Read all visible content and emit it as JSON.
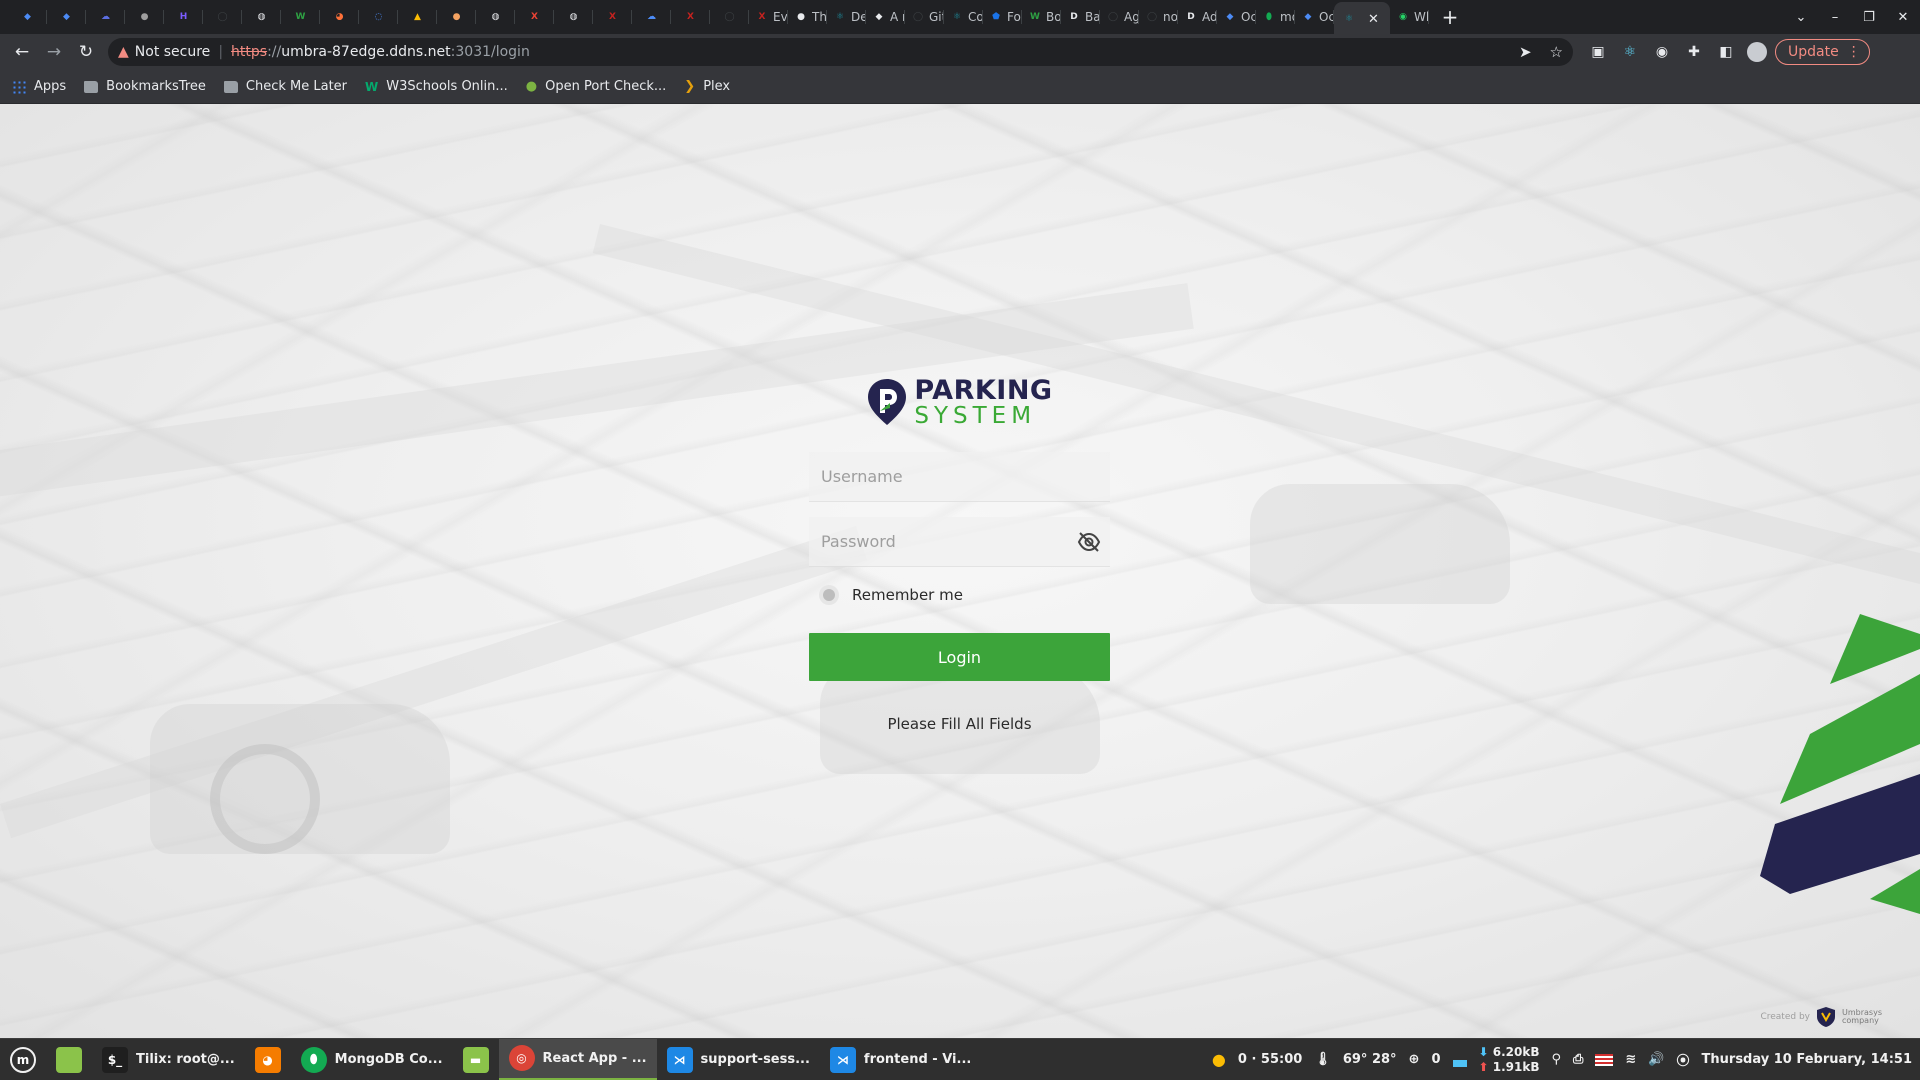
{
  "browser": {
    "tabs": [
      {
        "icon": "diamond-icon",
        "color": "#4c8bf5",
        "label": ""
      },
      {
        "icon": "diamond-icon",
        "color": "#4c8bf5",
        "label": ""
      },
      {
        "icon": "cloud-icon",
        "color": "#5b6ee1",
        "label": ""
      },
      {
        "icon": "apple-icon",
        "color": "#9e9e9e",
        "label": ""
      },
      {
        "icon": "h-icon",
        "color": "#7b5cff",
        "label": ""
      },
      {
        "icon": "github-icon",
        "color": "#3c4043",
        "label": ""
      },
      {
        "icon": "globe-icon",
        "color": "#e8eaed",
        "label": ""
      },
      {
        "icon": "w-icon",
        "color": "#2ea043",
        "label": ""
      },
      {
        "icon": "fox-icon",
        "color": "#ff7139",
        "label": ""
      },
      {
        "icon": "ball-icon",
        "color": "#4c8bf5",
        "label": ""
      },
      {
        "icon": "warning-icon",
        "color": "#fbbc04",
        "label": ""
      },
      {
        "icon": "cookie-icon",
        "color": "#f4a261",
        "label": ""
      },
      {
        "icon": "globe-icon",
        "color": "#e8eaed",
        "label": ""
      },
      {
        "icon": "x-icon",
        "color": "#ea4335",
        "label": ""
      },
      {
        "icon": "globe-icon",
        "color": "#e8eaed",
        "label": ""
      },
      {
        "icon": "x-icon",
        "color": "#c5221f",
        "label": ""
      },
      {
        "icon": "cloud-icon",
        "color": "#4c8bf5",
        "label": ""
      },
      {
        "icon": "x-icon",
        "color": "#c5221f",
        "label": ""
      },
      {
        "icon": "github-icon",
        "color": "#3c4043",
        "label": ""
      },
      {
        "icon": "x-icon",
        "color": "#c5221f",
        "label": "Ev"
      },
      {
        "icon": "user-icon",
        "color": "#e8eaed",
        "label": "Th"
      },
      {
        "icon": "react-icon",
        "color": "#1e8e9e",
        "label": "De"
      },
      {
        "icon": "bird-icon",
        "color": "#e8eaed",
        "label": "A r"
      },
      {
        "icon": "github-icon",
        "color": "#3c4043",
        "label": "Git"
      },
      {
        "icon": "react-icon",
        "color": "#1e8e9e",
        "label": "Co"
      },
      {
        "icon": "shield-icon",
        "color": "#1a73e8",
        "label": "Fo"
      },
      {
        "icon": "w-icon",
        "color": "#2ea043",
        "label": "Bo"
      },
      {
        "icon": "dev-icon",
        "color": "#e8eaed",
        "label": "Ba"
      },
      {
        "icon": "github-icon",
        "color": "#3c4043",
        "label": "Ag"
      },
      {
        "icon": "github-icon",
        "color": "#3c4043",
        "label": "no"
      },
      {
        "icon": "dev-icon",
        "color": "#e8eaed",
        "label": "Ad"
      },
      {
        "icon": "diamond-icon",
        "color": "#4c8bf5",
        "label": "Oc"
      },
      {
        "icon": "leaf-icon",
        "color": "#13aa52",
        "label": "mo"
      },
      {
        "icon": "diamond-icon",
        "color": "#4c8bf5",
        "label": "Oc"
      }
    ],
    "active_tab": {
      "icon": "react-icon",
      "color": "#1e8e9e",
      "label": ""
    },
    "after_tabs": [
      {
        "icon": "whatsapp-icon",
        "color": "#25d366",
        "label": "Wl"
      }
    ],
    "security_label": "Not secure",
    "url_protocol": "https",
    "url_separator": "://",
    "url_host": "umbra-87edge.ddns.net",
    "url_rest": ":3031/login",
    "update_label": "Update",
    "bookmarks": [
      {
        "icon": "apps-icon",
        "label": "Apps"
      },
      {
        "icon": "folder-icon",
        "label": "BookmarksTree"
      },
      {
        "icon": "folder-icon",
        "label": "Check Me Later"
      },
      {
        "icon": "w3schools-icon",
        "label": "W3Schools Onlin..."
      },
      {
        "icon": "globe-icon",
        "label": "Open Port Check..."
      },
      {
        "icon": "plex-icon",
        "label": "Plex"
      }
    ]
  },
  "login": {
    "logo_line1": "PARKING",
    "logo_line2": "SYSTEM",
    "username_placeholder": "Username",
    "password_placeholder": "Password",
    "remember_label": "Remember me",
    "login_label": "Login",
    "error_message": "Please Fill All Fields",
    "created_by": "Created by",
    "creator_name_1": "Umbrasys",
    "creator_name_2": "company",
    "colors": {
      "brand_navy": "#25244f",
      "brand_green": "#3ca43a"
    }
  },
  "taskbar": {
    "items": [
      {
        "icon": "terminal-icon",
        "label": "Tilix: root@...",
        "color": "#1f1f1f"
      },
      {
        "icon": "fox-icon",
        "label": "",
        "color": "#f57c00"
      },
      {
        "icon": "leaf-icon",
        "label": "MongoDB Co...",
        "color": "#13aa52"
      },
      {
        "icon": "folder-icon",
        "label": "",
        "color": "#8bc34a"
      },
      {
        "icon": "chrome-icon",
        "label": "React App - ...",
        "color": "#db4437"
      },
      {
        "icon": "vscode-icon",
        "label": "support-sess...",
        "color": "#1e88e5"
      },
      {
        "icon": "vscode-icon",
        "label": "frontend - Vi...",
        "color": "#1e88e5"
      }
    ],
    "tray_timer": "0 · 55:00",
    "tray_temp": "69°  28°",
    "tray_count": "0",
    "net_down": "6.20kB",
    "net_up": "1.91kB",
    "clock": "Thursday 10 February, 14:51"
  }
}
